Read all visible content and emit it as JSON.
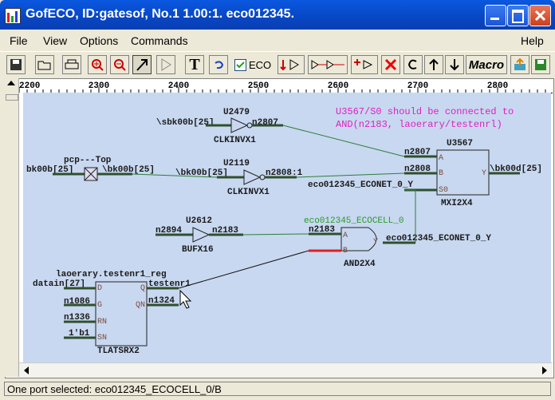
{
  "window": {
    "title": "GofECO, ID:gatesof, No.1 1.00:1. eco012345."
  },
  "menu": [
    "File",
    "View",
    "Options",
    "Commands",
    "Help"
  ],
  "toolbar": {
    "eco_checkbox_label": "ECO",
    "eco_checked": true,
    "macro_label": "Macro",
    "text_tool_label": "T"
  },
  "ruler": {
    "ticks": [
      "2200",
      "2300",
      "2400",
      "2500",
      "2600",
      "2700",
      "2800"
    ]
  },
  "schematic": {
    "note_line1": "U3567/S0 should be connected to",
    "note_line2": "AND(n2183, laoerary/testenrl)",
    "cells": {
      "u2479": {
        "instance": "U2479",
        "type": "CLKINVX1",
        "in_net": "\\sbk00b[25]",
        "out_net": "n2807"
      },
      "u2119": {
        "instance": "U2119",
        "type": "CLKINVX1",
        "in_net": "\\bk00b[25]",
        "out_net": "n2808:1"
      },
      "pcp": {
        "instance": "pcp---Top",
        "left_net": "bk00b[25]",
        "right_net": "\\bk00b[25]"
      },
      "u3567": {
        "instance": "U3567",
        "type": "MXI2X4",
        "pin_a": "A",
        "pin_b": "B",
        "pin_s0": "S0",
        "pin_y": "Y",
        "net_a": "n2807",
        "net_b": "n2808",
        "net_s0": "eco012345_ECONET_0_Y",
        "net_y": "\\bk00d[25]"
      },
      "u2612": {
        "instance": "U2612",
        "type": "BUFX16",
        "in_net": "n2894",
        "out_net": "n2183"
      },
      "ecocell": {
        "instance": "eco012345_ECOCELL_0",
        "type": "AND2X4",
        "pin_a": "A",
        "pin_b": "B",
        "pin_y": "Y",
        "net_a": "n2183",
        "net_y": "eco012345_ECONET_0_Y"
      },
      "latch": {
        "instance": "laoerary.testenr1_reg",
        "type": "TLATSRX2",
        "pin_d": "D",
        "pin_g": "G",
        "pin_rn": "RN",
        "pin_sn": "SN",
        "pin_q": "Q",
        "pin_qn": "QN",
        "net_d": "datain[27]",
        "net_g": "n1086",
        "net_rn": "n1336",
        "net_sn": "1'b1",
        "net_q": "testenr1",
        "net_qn": "n1324"
      }
    }
  },
  "status": {
    "text": "One port selected: eco012345_ECOCELL_0/B"
  },
  "colors": {
    "title_bar": "#0846c4",
    "schematic_bg": "#c8d8f0",
    "wire": "#2f7d3a",
    "label_ink": "#1a1a1a",
    "note_text": "#e020c0",
    "eco_instance_text": "#2a9a2a",
    "selected_wire": "#e02020",
    "pin_text": "#7a4a3a"
  }
}
